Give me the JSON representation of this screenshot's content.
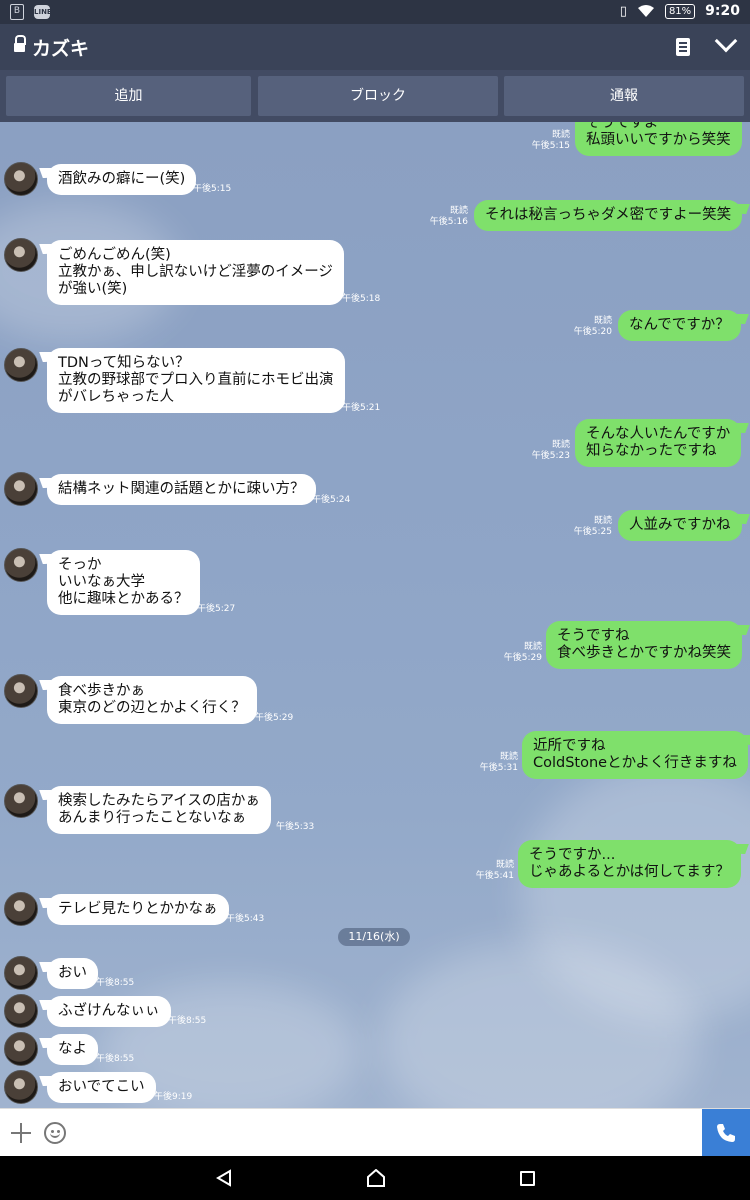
{
  "statusbar": {
    "battery": "81%",
    "time": "9:20",
    "line_badge": "LINE",
    "left_badge": "B"
  },
  "header": {
    "title": "カズキ"
  },
  "actions": {
    "add": "追加",
    "block": "ブロック",
    "report": "通報"
  },
  "date_separator": "11/16(水)",
  "read_label": "既読",
  "messages": [
    {
      "side": "out",
      "text": "そうですよー\n私頭いいですから笑笑",
      "time": "午後5:15",
      "read": "既読"
    },
    {
      "side": "in",
      "text": "酒飲みの癖にー(笑)",
      "time": "午後5:15"
    },
    {
      "side": "out",
      "text": "それは秘言っちゃダメ密ですよー笑笑",
      "time": "午後5:16",
      "read": "既読"
    },
    {
      "side": "in",
      "text": "ごめんごめん(笑)\n立教かぁ、申し訳ないけど淫夢のイメージ\nが強い(笑)",
      "time": "午後5:18"
    },
    {
      "side": "out",
      "text": "なんでですか？",
      "time": "午後5:20",
      "read": "既読"
    },
    {
      "side": "in",
      "text": "TDNって知らない？\n立教の野球部でプロ入り直前にホモビ出演\nがバレちゃった人",
      "time": "午後5:21"
    },
    {
      "side": "out",
      "text": "そんな人いたんですか\n知らなかったですね",
      "time": "午後5:23",
      "read": "既読"
    },
    {
      "side": "in",
      "text": "結構ネット関連の話題とかに疎い方？",
      "time": "午後5:24"
    },
    {
      "side": "out",
      "text": "人並みですかね",
      "time": "午後5:25",
      "read": "既読"
    },
    {
      "side": "in",
      "text": "そっか\nいいなぁ大学\n他に趣味とかある？",
      "time": "午後5:27"
    },
    {
      "side": "out",
      "text": "そうですね\n食べ歩きとかですかね笑笑",
      "time": "午後5:29",
      "read": "既読"
    },
    {
      "side": "in",
      "text": "食べ歩きかぁ\n東京のどの辺とかよく行く？",
      "time": "午後5:29"
    },
    {
      "side": "out",
      "text": "近所ですね\nColdStoneとかよく行きますね",
      "time": "午後5:31",
      "read": "既読"
    },
    {
      "side": "in",
      "text": "検索したみたらアイスの店かぁ\nあんまり行ったことないなぁ",
      "time": "午後5:33"
    },
    {
      "side": "out",
      "text": "そうですか...\nじゃあよるとかは何してます？",
      "time": "午後5:41",
      "read": "既読"
    },
    {
      "side": "in",
      "text": "テレビ見たりとかかなぁ",
      "time": "午後5:43"
    },
    {
      "side": "in",
      "text": "おい",
      "time": "午後8:55"
    },
    {
      "side": "in",
      "text": "ふざけんなぃぃ",
      "time": "午後8:55"
    },
    {
      "side": "in",
      "text": "なよ",
      "time": "午後8:55"
    },
    {
      "side": "in",
      "text": "おいでてこい",
      "time": "午後9:19"
    }
  ],
  "colors": {
    "out_bubble": "#7fe06b",
    "in_bubble": "#ffffff",
    "header": "#3a4358",
    "call": "#3a7fd6"
  }
}
